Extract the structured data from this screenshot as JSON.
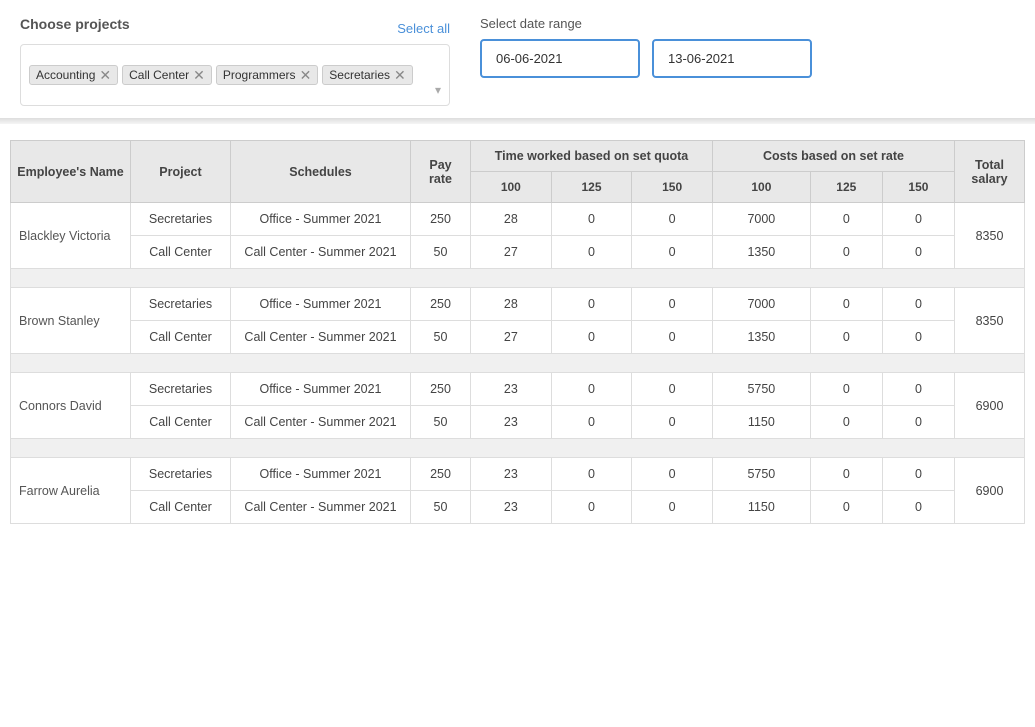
{
  "header": {
    "choose_projects_label": "Choose projects",
    "select_all_label": "Select all",
    "tags": [
      "Accounting",
      "Call Center",
      "Programmers",
      "Secretaries"
    ],
    "date_range_label": "Select date range",
    "date_start": "06-06-2021",
    "date_end": "13-06-2021"
  },
  "table": {
    "columns": {
      "employee_name": "Employee's Name",
      "project": "Project",
      "schedules": "Schedules",
      "pay_rate": "Pay rate",
      "time_worked_group": "Time worked based on set quota",
      "costs_group": "Costs based on set rate",
      "total_salary": "Total salary"
    },
    "sub_columns": {
      "tw_100": "100",
      "tw_125": "125",
      "tw_150": "150",
      "c_100": "100",
      "c_125": "125",
      "c_150": "150"
    },
    "rows": [
      {
        "employee": "Blackley Victoria",
        "total_salary": "8350",
        "sub_rows": [
          {
            "project": "Secretaries",
            "schedule": "Office - Summer 2021",
            "pay_rate": "250",
            "tw_100": "28",
            "tw_125": "0",
            "tw_150": "0",
            "c_100": "7000",
            "c_125": "0",
            "c_150": "0"
          },
          {
            "project": "Call Center",
            "schedule": "Call Center - Summer 2021",
            "pay_rate": "50",
            "tw_100": "27",
            "tw_125": "0",
            "tw_150": "0",
            "c_100": "1350",
            "c_125": "0",
            "c_150": "0"
          }
        ]
      },
      {
        "employee": "Brown Stanley",
        "total_salary": "8350",
        "sub_rows": [
          {
            "project": "Secretaries",
            "schedule": "Office - Summer 2021",
            "pay_rate": "250",
            "tw_100": "28",
            "tw_125": "0",
            "tw_150": "0",
            "c_100": "7000",
            "c_125": "0",
            "c_150": "0"
          },
          {
            "project": "Call Center",
            "schedule": "Call Center - Summer 2021",
            "pay_rate": "50",
            "tw_100": "27",
            "tw_125": "0",
            "tw_150": "0",
            "c_100": "1350",
            "c_125": "0",
            "c_150": "0"
          }
        ]
      },
      {
        "employee": "Connors David",
        "total_salary": "6900",
        "sub_rows": [
          {
            "project": "Secretaries",
            "schedule": "Office - Summer 2021",
            "pay_rate": "250",
            "tw_100": "23",
            "tw_125": "0",
            "tw_150": "0",
            "c_100": "5750",
            "c_125": "0",
            "c_150": "0"
          },
          {
            "project": "Call Center",
            "schedule": "Call Center - Summer 2021",
            "pay_rate": "50",
            "tw_100": "23",
            "tw_125": "0",
            "tw_150": "0",
            "c_100": "1150",
            "c_125": "0",
            "c_150": "0"
          }
        ]
      },
      {
        "employee": "Farrow Aurelia",
        "total_salary": "6900",
        "sub_rows": [
          {
            "project": "Secretaries",
            "schedule": "Office - Summer 2021",
            "pay_rate": "250",
            "tw_100": "23",
            "tw_125": "0",
            "tw_150": "0",
            "c_100": "5750",
            "c_125": "0",
            "c_150": "0"
          },
          {
            "project": "Call Center",
            "schedule": "Call Center - Summer 2021",
            "pay_rate": "50",
            "tw_100": "23",
            "tw_125": "0",
            "tw_150": "0",
            "c_100": "1150",
            "c_125": "0",
            "c_150": "0"
          }
        ]
      }
    ]
  }
}
